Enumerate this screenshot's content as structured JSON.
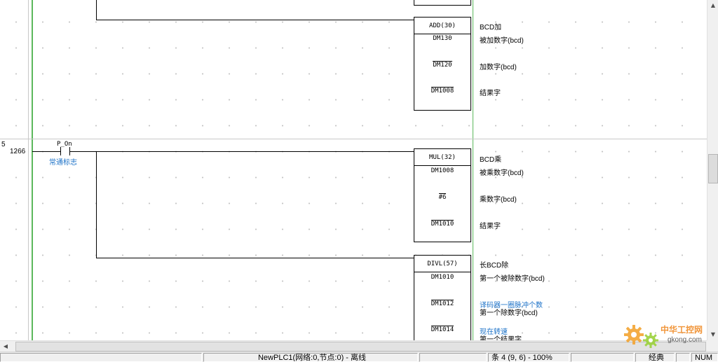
{
  "rungs": [
    {
      "number": "5",
      "step": "1266",
      "contact": {
        "name": "P_On",
        "comment": "常通标志"
      }
    }
  ],
  "blocks": [
    {
      "instruction": "ADD(30)",
      "comment": "BCD加",
      "operands": [
        {
          "value": "DM130",
          "comment": "被加数字(bcd)"
        },
        {
          "value": "DM120",
          "comment": "加数字(bcd)"
        },
        {
          "value": "DM1008",
          "comment": "结果字"
        }
      ]
    },
    {
      "instruction": "MUL(32)",
      "comment": "BCD乘",
      "operands": [
        {
          "value": "DM1008",
          "comment": "被乘数字(bcd)"
        },
        {
          "value": "#6",
          "comment": "乘数字(bcd)"
        },
        {
          "value": "DM1010",
          "comment": "结果字"
        }
      ]
    },
    {
      "instruction": "DIVL(57)",
      "comment": "长BCD除",
      "operands": [
        {
          "value": "DM1010",
          "comment": "第一个被除数字(bcd)"
        },
        {
          "value": "DM1012",
          "comment": "第一个除数字(bcd)",
          "note": "译码器一圈脉冲个数"
        },
        {
          "value": "DM1014",
          "comment": "第一个结果字",
          "note": "现在转速"
        }
      ]
    }
  ],
  "scrollbars": {
    "up_icon": "arrow-up-icon",
    "down_icon": "arrow-down-icon",
    "left_icon": "arrow-left-icon",
    "right_icon": "arrow-right-icon"
  },
  "status": {
    "plc": "NewPLC1(网络:0,节点:0) - 离线",
    "position": "条 4 (9, 6)  - 100%",
    "mode": "经典",
    "num": "NUM"
  },
  "watermark": {
    "title": "中华工控网",
    "url": "gkong.com"
  },
  "colors": {
    "power_rail": "#5cb85c",
    "comment_blue": "#1e73c8",
    "watermark_orange": "#f08a24"
  }
}
